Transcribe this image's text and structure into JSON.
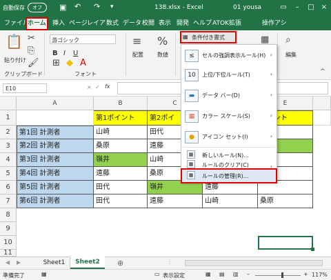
{
  "titlebar": {
    "autosave": "自動保存",
    "autosave_state": "オフ",
    "filename": "138.xlsx - Excel",
    "user": "01 yousa"
  },
  "tabs": [
    "ファイル",
    "ホーム",
    "挿入",
    "ページ",
    "レイア",
    "数式",
    "データ",
    "校閲",
    "表示",
    "開発",
    "ヘルプ",
    "ATOK拡張",
    "操作アシ"
  ],
  "ribbon": {
    "paste": "貼り付け",
    "clipboard": "クリップボード",
    "font_name": "游ゴシック",
    "font_group": "フォント",
    "align": "配置",
    "number": "数値",
    "cond_format": "条件付き書式",
    "edit": "編集"
  },
  "formula_bar": {
    "namebox": "E10",
    "fx": "fx",
    "cancel": "×",
    "enter": "✓"
  },
  "columns": [
    "A",
    "B",
    "C",
    "E"
  ],
  "rows": [
    "1",
    "2",
    "3",
    "4",
    "5",
    "6",
    "7",
    "8",
    "9",
    "10",
    "11"
  ],
  "cells": {
    "b1": "第1ポイント",
    "c1": "第2ポイ",
    "e1": "ポイント",
    "a": [
      "第1回 計測者",
      "第2回 計測者",
      "第3回 計測者",
      "第4回 計測者",
      "第5回 計測者",
      "第6回 計測者"
    ],
    "b": [
      "山崎",
      "桑原",
      "嶺井",
      "遠藤",
      "田代",
      "田代"
    ],
    "c": [
      "田代",
      "遠藤",
      "山崎",
      "桑原",
      "嶺井",
      "遠藤"
    ],
    "d": [
      "",
      "",
      "",
      "",
      "遠藤",
      "山崎"
    ],
    "e": [
      "",
      "",
      "",
      "",
      "",
      "桑原"
    ]
  },
  "menu": {
    "items": [
      {
        "label": "セルの強調表示ルール(H)",
        "arrow": "›",
        "icon": "≤"
      },
      {
        "label": "上位/下位ルール(T)",
        "arrow": "›",
        "icon": "10"
      },
      {
        "label": "データ バー(D)",
        "arrow": "›",
        "icon": "▬"
      },
      {
        "label": "カラー スケール(S)",
        "arrow": "›",
        "icon": "▦"
      },
      {
        "label": "アイコン セット(I)",
        "arrow": "›",
        "icon": "●"
      }
    ],
    "small": [
      {
        "label": "新しいルール(N)...",
        "icon": "▦"
      },
      {
        "label": "ルールのクリア(C)",
        "arrow": "›",
        "icon": "▦"
      },
      {
        "label": "ルールの管理(R)...",
        "icon": "▦"
      }
    ]
  },
  "sheets": [
    "Sheet1",
    "Sheet2"
  ],
  "status": {
    "ready": "準備完了",
    "display_settings": "表示設定",
    "zoom": "117%"
  },
  "colors": {
    "excel_green": "#217346",
    "yellow": "#ffff00",
    "green_fill": "#92d050",
    "blue_fill": "#bdd7ee",
    "red_highlight": "#e00000"
  }
}
